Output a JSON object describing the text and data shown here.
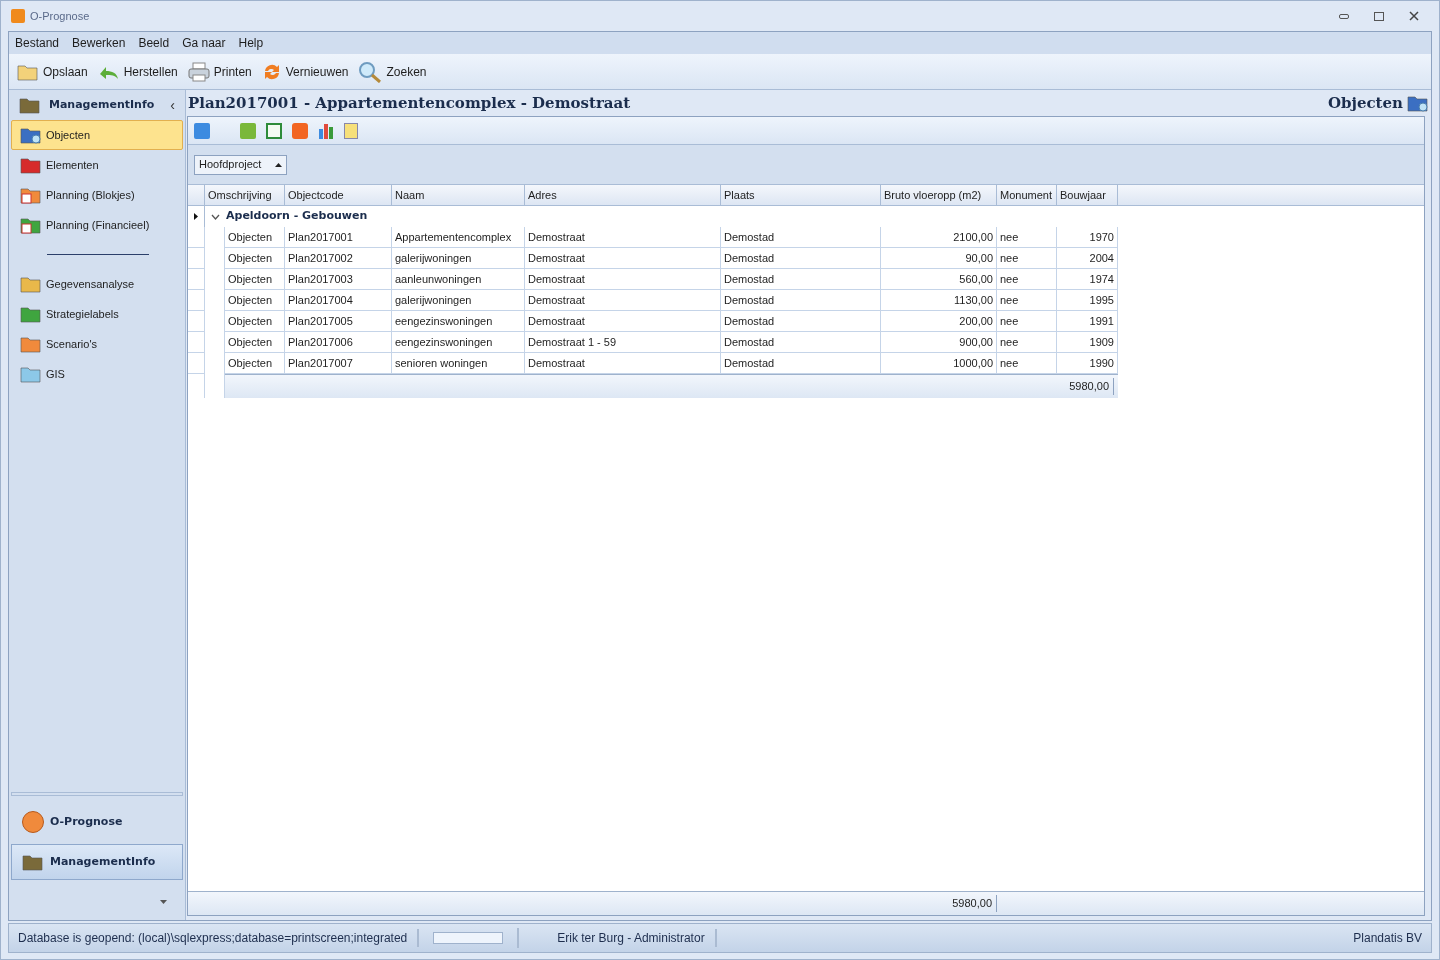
{
  "window": {
    "title": "O-Prognose"
  },
  "menu": [
    "Bestand",
    "Bewerken",
    "Beeld",
    "Ga naar",
    "Help"
  ],
  "toolbar": [
    "Opslaan",
    "Herstellen",
    "Printen",
    "Vernieuwen",
    "Zoeken"
  ],
  "sidebar": {
    "header": "ManagementInfo",
    "collapse": "‹",
    "sections": [
      {
        "items": [
          {
            "label": "Objecten",
            "selected": true
          },
          {
            "label": "Elementen",
            "selected": false
          },
          {
            "label": "Planning (Blokjes)",
            "selected": false
          },
          {
            "label": "Planning (Financieel)",
            "selected": false
          }
        ]
      },
      {
        "items": [
          {
            "label": "Gegevensanalyse",
            "selected": false
          },
          {
            "label": "Strategielabels",
            "selected": false
          },
          {
            "label": "Scenario's",
            "selected": false
          },
          {
            "label": "GIS",
            "selected": false
          }
        ]
      }
    ],
    "modules": [
      {
        "label": "O-Prognose",
        "selected": false
      },
      {
        "label": "ManagementInfo",
        "selected": true
      }
    ]
  },
  "page": {
    "title": "Plan2017001 - Appartementencomplex - Demostraat",
    "section": "Objecten"
  },
  "grid": {
    "group_by": "Hoofdproject",
    "columns": [
      "Omschrijving",
      "Objectcode",
      "Naam",
      "Adres",
      "Plaats",
      "Bruto vloeropp (m2)",
      "Monument",
      "Bouwjaar"
    ],
    "group": {
      "label": "Apeldoorn - Gebouwen",
      "expanded": true,
      "total": "5980,00"
    },
    "rows": [
      [
        "Objecten",
        "Plan2017001",
        "Appartementencomplex",
        "Demostraat",
        "Demostad",
        "2100,00",
        "nee",
        "1970"
      ],
      [
        "Objecten",
        "Plan2017002",
        "galerijwoningen",
        "Demostraat",
        "Demostad",
        "90,00",
        "nee",
        "2004"
      ],
      [
        "Objecten",
        "Plan2017003",
        "aanleunwoningen",
        "Demostraat",
        "Demostad",
        "560,00",
        "nee",
        "1974"
      ],
      [
        "Objecten",
        "Plan2017004",
        "galerijwoningen",
        "Demostraat",
        "Demostad",
        "1130,00",
        "nee",
        "1995"
      ],
      [
        "Objecten",
        "Plan2017005",
        "eengezinswoningen",
        "Demostraat",
        "Demostad",
        "200,00",
        "nee",
        "1991"
      ],
      [
        "Objecten",
        "Plan2017006",
        "eengezinswoningen",
        "Demostraat 1 - 59",
        "Demostad",
        "900,00",
        "nee",
        "1909"
      ],
      [
        "Objecten",
        "Plan2017007",
        "senioren woningen",
        "Demostraat",
        "Demostad",
        "1000,00",
        "nee",
        "1990"
      ]
    ],
    "footer_total": "5980,00"
  },
  "status_bar": {
    "progress": {
      "level": 0
    },
    "database": "Database is geopend: (local)\\sqlexpress;database=printscreen;integrated",
    "user": "Erik ter Burg - Administrator",
    "company": "Plandatis BV"
  }
}
